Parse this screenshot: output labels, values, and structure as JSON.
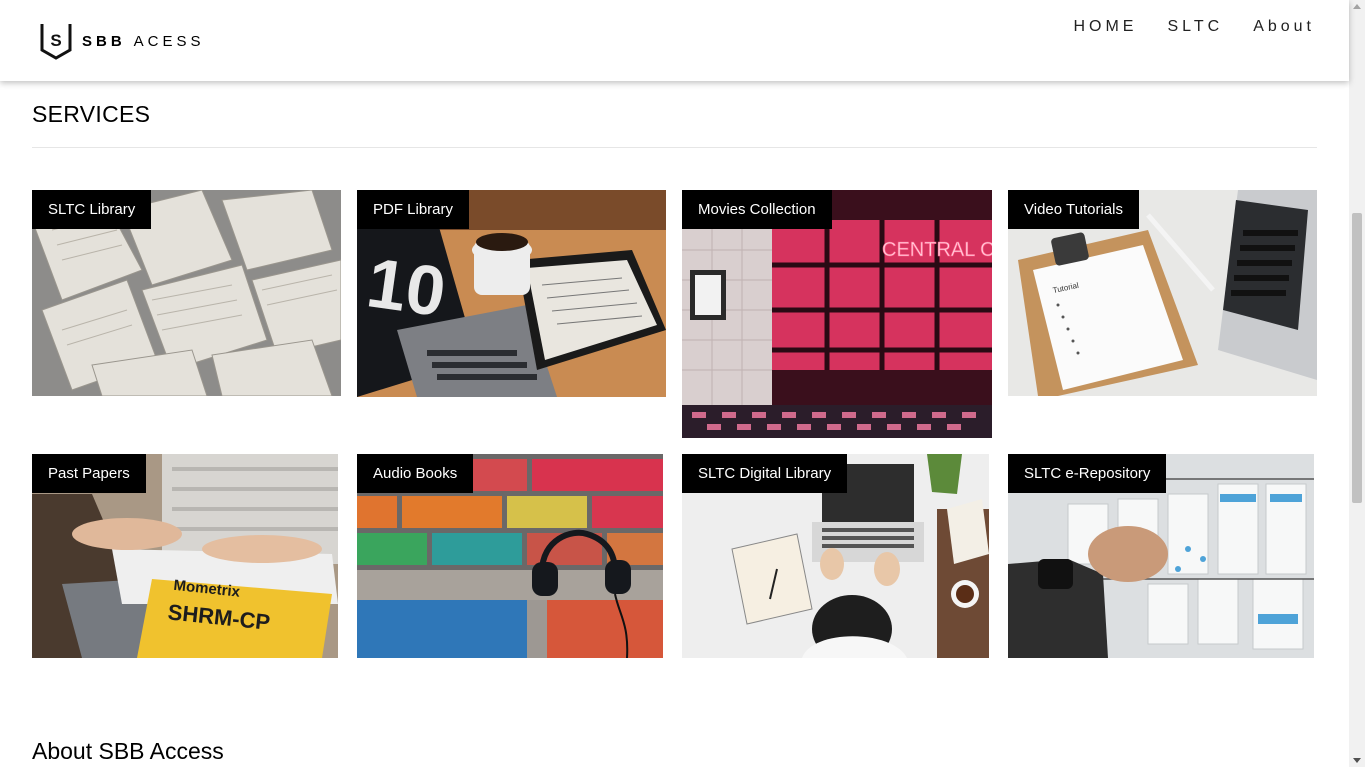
{
  "header": {
    "brand_bold": "SBB",
    "brand_rest": "ACESS",
    "logo_letter": "S",
    "nav": [
      "HOME",
      "SLTC",
      "About"
    ]
  },
  "services": {
    "title": "SERVICES",
    "cards": [
      {
        "label": "SLTC Library",
        "image": "open-books-photo"
      },
      {
        "label": "PDF Library",
        "image": "laptop-tablet-coffee-photo"
      },
      {
        "label": "Movies Collection",
        "image": "central-cinema-photo",
        "sign": "CENTRAL CINEMA"
      },
      {
        "label": "Video Tutorials",
        "image": "clipboard-laptop-photo",
        "sign": "Tutorial"
      },
      {
        "label": "Past Papers",
        "image": "study-guide-photo",
        "sign": "SHRM-CP"
      },
      {
        "label": "Audio Books",
        "image": "headphones-brick-wall-photo"
      },
      {
        "label": "SLTC Digital Library",
        "image": "desk-laptop-topview-photo"
      },
      {
        "label": "SLTC e-Repository",
        "image": "whiteboard-planning-photo"
      }
    ]
  },
  "about": {
    "title": "About SBB Access"
  }
}
